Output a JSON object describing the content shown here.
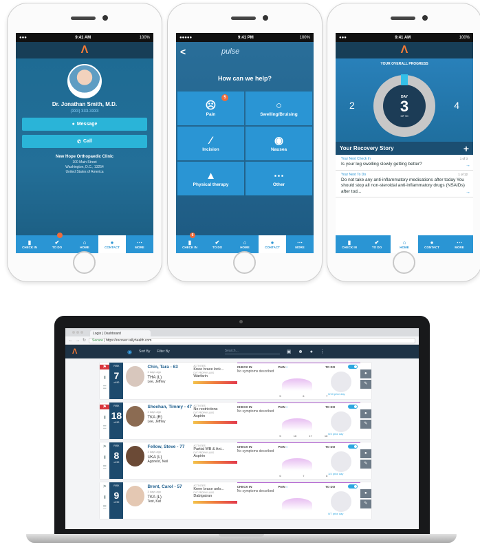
{
  "phone1": {
    "status": {
      "left": "●●●",
      "time": "9:41 AM",
      "right": "100%"
    },
    "logo": "Λ",
    "doctor_name": "Dr. Jonathan Smith, M.D.",
    "doctor_phone": "(333) 333-3333",
    "message_label": "Message",
    "call_label": "Call",
    "clinic": "New Hope Orthopaedic Clinic",
    "address_line1": "100 Main Street",
    "address_line2": "Washington, D.C., 13254",
    "address_line3": "United States of America",
    "tabs": [
      "CHECK IN",
      "TO DO",
      "HOME",
      "CONTACT",
      "MORE"
    ],
    "todo_badge": ""
  },
  "phone2": {
    "status": {
      "left": "●●●●●",
      "time": "9:41 PM",
      "right": "100%"
    },
    "back": "<",
    "app_title": "pulse",
    "question": "How can we help?",
    "cells": [
      "Pain",
      "Swelling/Bruising",
      "Incision",
      "Nausea",
      "Physical therapy",
      "Other"
    ],
    "pain_badge": "5",
    "tabs": [
      "CHECK IN",
      "TO DO",
      "HOME",
      "CONTACT",
      "MORE"
    ],
    "checkin_badge": "6"
  },
  "phone3": {
    "status": {
      "left": "●●●",
      "time": "9:41 AM",
      "right": "100%"
    },
    "logo": "Λ",
    "progress_title": "YOUR OVERALL PROGRESS",
    "day_label": "DAY",
    "day_number": "3",
    "day_of": "OF 90",
    "prev_day": "2",
    "next_day": "4",
    "story_title": "Your Recovery Story",
    "cards": [
      {
        "title": "Your Next Check In",
        "page": "1 of 3",
        "body": "Is your leg swelling slowly getting better?"
      },
      {
        "title": "Your Next To Do",
        "page": "1 of 12",
        "body": "Do not take any anti-inflammatory medications after today You should stop all non-steroidal anti-inflammatory drugs (NSAIDs) after tod..."
      }
    ],
    "tabs": [
      "CHECK IN",
      "TO DO",
      "HOME",
      "CONTACT",
      "MORE"
    ]
  },
  "laptop": {
    "tab_title": "Login | Dashboard",
    "url_secure": "Secure",
    "url": "https://recover.rallyhealth.com",
    "logo": "Λ",
    "sort_by": "Sort By",
    "filter_by": "Filter By",
    "search_placeholder": "Search...",
    "patients": [
      {
        "flag": "⚑",
        "day": "7",
        "of": "of 90",
        "name": "Chin, Tara - 63",
        "ago": "3 days ago",
        "proc": "THA (L)",
        "doctor": "Lee, Jeffrey",
        "activities": "Knee brace lock...",
        "medication": "Warfarin",
        "checkin": "No symptoms described",
        "ticks": [
          "5",
          "6",
          "7"
        ],
        "todo": "0/10 prior day",
        "photo": "#d8c7bd"
      },
      {
        "flag": "⚑",
        "day": "18",
        "of": "of 90",
        "name": "Sheehan, Timmy - 47",
        "ago": "3 days ago",
        "proc": "TKA (R)",
        "doctor": "Lee, Jeffrey",
        "activities": "No restrictions",
        "medication": "Aspirin",
        "checkin": "No symptoms described",
        "ticks": [
          "5",
          "16",
          "17",
          "18"
        ],
        "todo": "0/3 prior day",
        "photo": "#8b6b52"
      },
      {
        "flag": "⚑",
        "day": "8",
        "of": "of 90",
        "name": "Fellow, Steve - 77",
        "ago": "3 days ago",
        "proc": "UKA (L)",
        "doctor": "Agonest, Neil",
        "activities": "Partial WB & Ani...",
        "medication": "Aspirin",
        "checkin": "No symptoms described",
        "ticks": [
          "6",
          "7",
          "8"
        ],
        "todo": "1/4 prior day",
        "photo": "#6b4a36"
      },
      {
        "flag": "⚑",
        "day": "9",
        "of": "of 90",
        "name": "Brent, Carol - 57",
        "ago": "3 days ago",
        "proc": "TKA (L)",
        "doctor": "Test, Kat",
        "activities": "Knee brace unlo...",
        "medication": "Dabigatran",
        "checkin": "No symptoms described",
        "ticks": [
          "",
          "",
          ""
        ],
        "todo": "0/7 prior day",
        "photo": "#e4c8b3"
      }
    ],
    "labels": {
      "activities": "ACTIVITIES",
      "medication": "DVT PROPHYLAXIS",
      "checkin": "CHECK IN",
      "pain": "PAIN",
      "todo": "TO DO",
      "risk": "RISK"
    }
  }
}
